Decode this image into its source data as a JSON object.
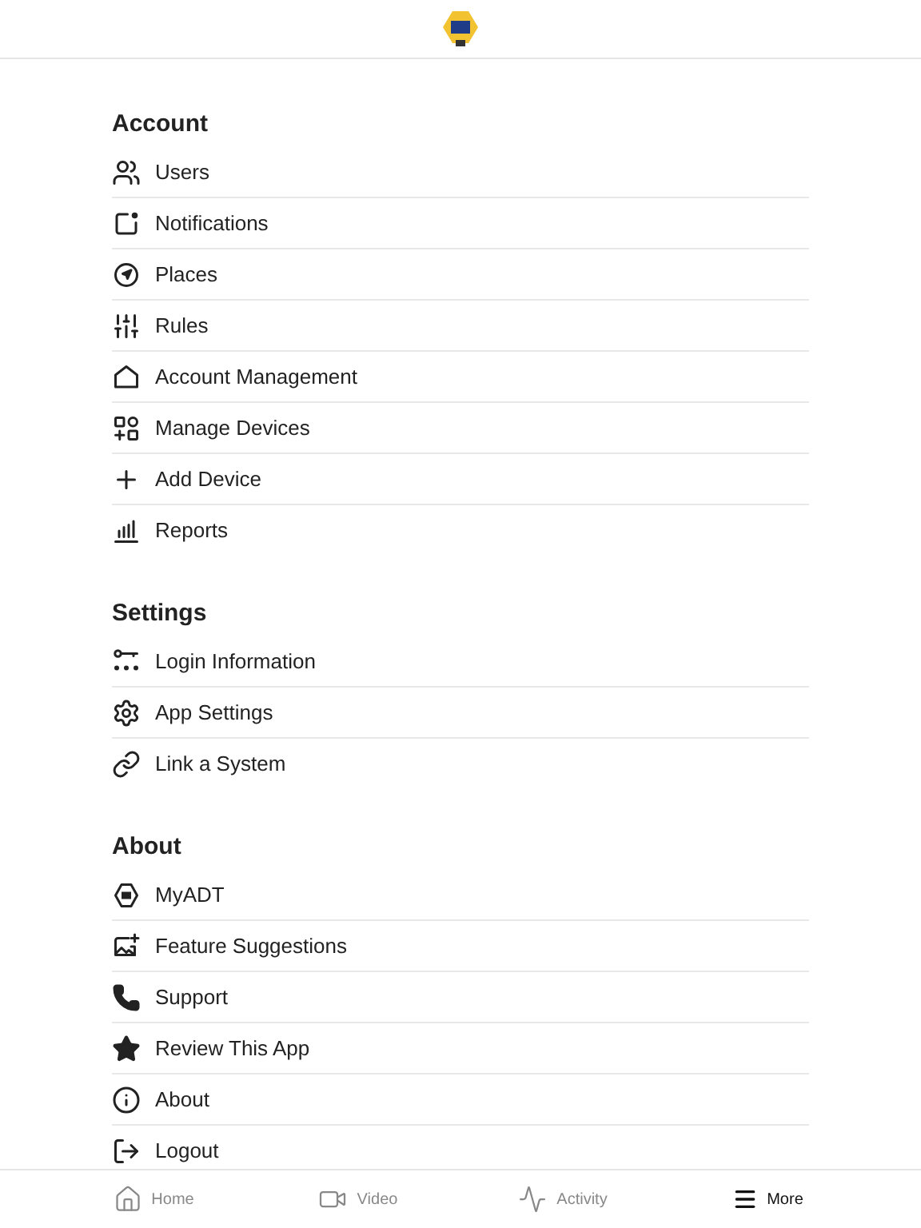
{
  "sections": [
    {
      "title": "Account",
      "items": [
        {
          "label": "Users"
        },
        {
          "label": "Notifications"
        },
        {
          "label": "Places"
        },
        {
          "label": "Rules"
        },
        {
          "label": "Account Management"
        },
        {
          "label": "Manage Devices"
        },
        {
          "label": "Add Device"
        },
        {
          "label": "Reports"
        }
      ]
    },
    {
      "title": "Settings",
      "items": [
        {
          "label": "Login Information"
        },
        {
          "label": "App Settings"
        },
        {
          "label": "Link a System"
        }
      ]
    },
    {
      "title": "About",
      "items": [
        {
          "label": "MyADT"
        },
        {
          "label": "Feature Suggestions"
        },
        {
          "label": "Support"
        },
        {
          "label": "Review This App"
        },
        {
          "label": "About"
        },
        {
          "label": "Logout"
        }
      ]
    }
  ],
  "tab_bar": [
    {
      "label": "Home",
      "selected": false
    },
    {
      "label": "Video",
      "selected": false
    },
    {
      "label": "Activity",
      "selected": false
    },
    {
      "label": "More",
      "selected": true
    }
  ]
}
